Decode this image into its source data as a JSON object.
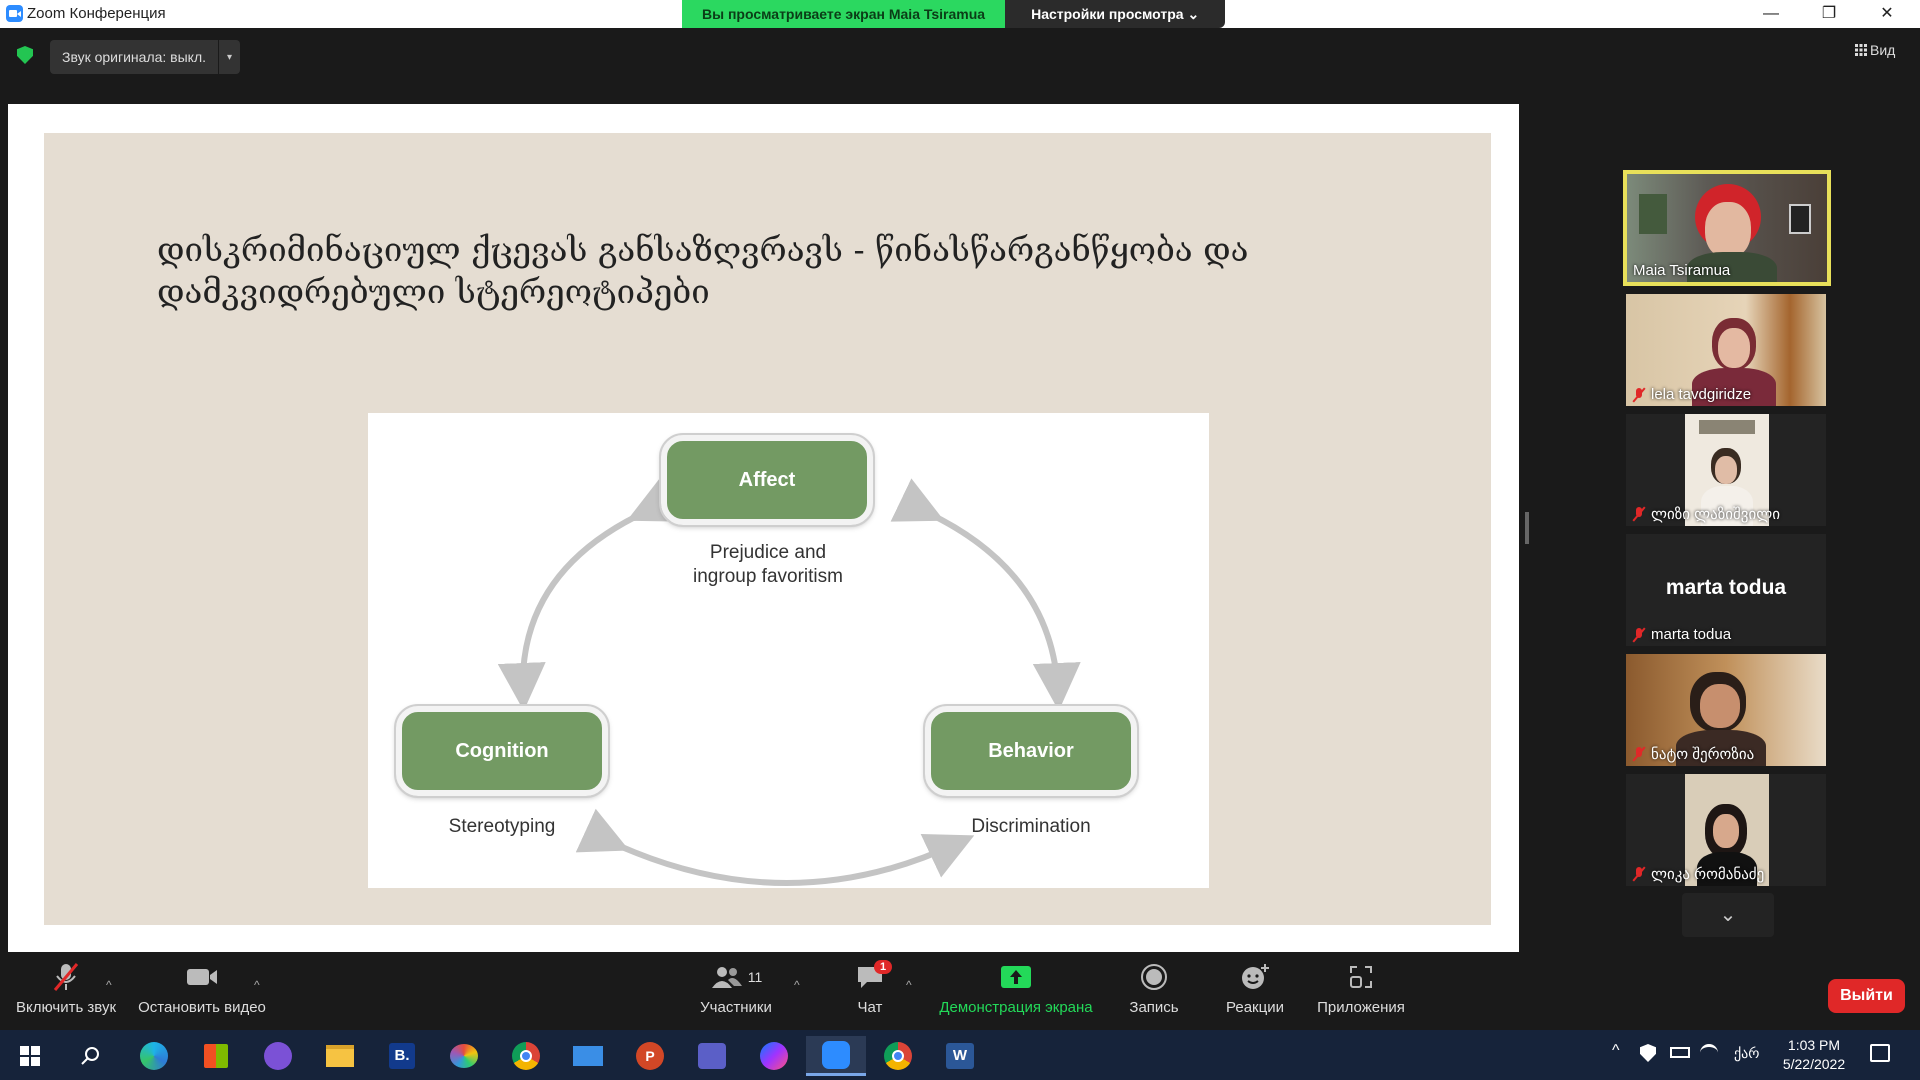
{
  "window": {
    "title": "Zoom Конференция",
    "minimize_glyph": "—",
    "restore_glyph": "❐",
    "close_glyph": "✕"
  },
  "share_banner": {
    "viewing_text": "Вы просматриваете экран Maia Tsiramua",
    "view_options_label": "Настройки просмотра ⌄"
  },
  "topbar": {
    "original_sound_label": "Звук оригинала: выкл.",
    "original_sound_caret": "▾",
    "view_label": "Вид",
    "view_icon": "grid-icon"
  },
  "slide": {
    "title": "დისკრიმინაციულ ქცევას განსაზღვრავს - წინასწარგანწყობა და დამკვიდრებული სტერეოტიპები",
    "nodes": {
      "affect": {
        "label": "Affect",
        "caption_line1": "Prejudice and",
        "caption_line2": "ingroup favoritism"
      },
      "cognition": {
        "label": "Cognition",
        "caption": "Stereotyping"
      },
      "behavior": {
        "label": "Behavior",
        "caption": "Discrimination"
      }
    },
    "node_color": "#739a63"
  },
  "participants": [
    {
      "name": "Maia Tsiramua",
      "muted": false,
      "active_speaker": true,
      "video": true
    },
    {
      "name": "lela tavdgiridze",
      "muted": true,
      "video": true
    },
    {
      "name": "ლიზი ლაზიშვილი",
      "muted": true,
      "video": true
    },
    {
      "name": "marta todua",
      "muted": true,
      "video": false,
      "display_name": "marta todua"
    },
    {
      "name": "ნატო შეროზია",
      "muted": true,
      "video": true
    },
    {
      "name": "ლიკა რომანაძე",
      "muted": true,
      "video": true
    }
  ],
  "participants_scroll_glyph": "⌄",
  "toolbar": {
    "unmute_label": "Включить звук",
    "stop_video_label": "Остановить видео",
    "participants_label": "Участники",
    "participants_count": "11",
    "chat_label": "Чат",
    "chat_badge": "1",
    "share_screen_label": "Демонстрация экрана",
    "record_label": "Запись",
    "reactions_label": "Реакции",
    "apps_label": "Приложения",
    "leave_label": "Выйти",
    "caret_glyph": "^",
    "accent_green": "#23d959",
    "leave_red": "#e02828"
  },
  "taskbar": {
    "time": "1:03 PM",
    "date": "5/22/2022",
    "language": "ქარ",
    "apps": [
      "windows-start",
      "search",
      "edge",
      "store",
      "viber",
      "file-explorer",
      "booking",
      "paint",
      "chrome",
      "mail",
      "powerpoint",
      "teams",
      "messenger",
      "zoom",
      "chrome",
      "word"
    ],
    "tray_chevron": "^",
    "word_letter": "W",
    "powerpoint_letter": "P",
    "booking_letter": "B."
  }
}
